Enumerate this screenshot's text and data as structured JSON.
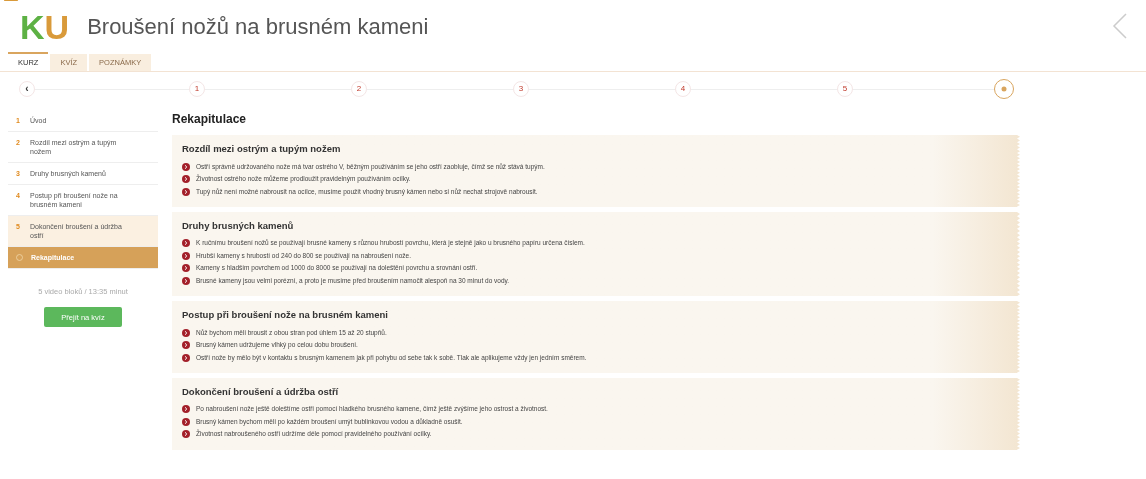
{
  "header": {
    "logo": {
      "left": "K",
      "right": "U"
    },
    "title": "Broušení nožů na brusném kameni"
  },
  "tabs": [
    {
      "label": "KURZ",
      "selected": true
    },
    {
      "label": "KVÍZ",
      "selected": false
    },
    {
      "label": "POZNÁMKY",
      "selected": false
    }
  ],
  "steps": [
    {
      "kind": "prev",
      "label": "‹",
      "selected": false
    },
    {
      "kind": "step",
      "label": "1",
      "selected": false
    },
    {
      "kind": "step",
      "label": "2",
      "selected": false
    },
    {
      "kind": "step",
      "label": "3",
      "selected": false
    },
    {
      "kind": "step",
      "label": "4",
      "selected": false
    },
    {
      "kind": "step",
      "label": "5",
      "selected": false
    },
    {
      "kind": "summary",
      "selected": true
    }
  ],
  "sidebar": {
    "items": [
      {
        "kind": "lesson",
        "number": "1",
        "label": "Úvod",
        "highlighted": false,
        "selected": false
      },
      {
        "kind": "lesson",
        "number": "2",
        "label": "Rozdíl mezi ostrým a tupým nožem",
        "highlighted": false,
        "selected": false
      },
      {
        "kind": "lesson",
        "number": "3",
        "label": "Druhy brusných kamenů",
        "highlighted": false,
        "selected": false
      },
      {
        "kind": "lesson",
        "number": "4",
        "label": "Postup při broušení nože na brusném kameni",
        "highlighted": false,
        "selected": false
      },
      {
        "kind": "lesson",
        "number": "5",
        "label": "Dokončení broušení a údržba ostří",
        "highlighted": true,
        "selected": false
      },
      {
        "kind": "summary",
        "label": "Rekapitulace",
        "highlighted": false,
        "selected": true
      }
    ],
    "summary": "5 video bloků / 13:35 minut",
    "quiz_button": "Přejít na kvíz"
  },
  "content": {
    "title": "Rekapitulace",
    "sections": [
      {
        "heading": "Rozdíl mezi ostrým a tupým nožem",
        "points": [
          "Ostří správně udržovaného nože má tvar ostrého V, běžným používáním se jeho ostří zaobluje, čímž se nůž stává tupým.",
          "Životnost ostrého nože můžeme prodloužit pravidelným používáním ocílky.",
          "Tupý nůž není možné nabrousit na ocílce, musíme použít vhodný brusný kámen nebo si nůž nechat strojově nabrousit."
        ]
      },
      {
        "heading": "Druhy brusných kamenů",
        "points": [
          "K ručnímu broušení nožů se používají brusné kameny s různou hrubostí povrchu, která je stejně jako u brusného papíru určena číslem.",
          "Hrubší kameny s hrubostí od 240 do 800 se používají na nabroušení nože.",
          "Kameny s hladším povrchem od 1000 do 8000 se používají na doleštění povrchu a srovnání ostří.",
          "Brusné kameny jsou velmi porézní, a proto je musíme před broušením namočit alespoň na 30 minut do vody."
        ]
      },
      {
        "heading": "Postup při broušení nože na brusném kameni",
        "points": [
          "Nůž bychom měli brousit z obou stran pod úhlem 15 až 20 stupňů.",
          "Brusný kámen udržujeme vlhký po celou dobu broušení.",
          "Ostří nože by mělo být v kontaktu s brusným kamenem jak při pohybu od sebe tak k sobě. Tlak ale aplikujeme vždy jen jedním směrem."
        ]
      },
      {
        "heading": "Dokončení broušení a údržba ostří",
        "points": [
          "Po nabroušení nože ještě doleštíme ostří pomocí hladkého brusného kamene, čímž ještě zvýšíme jeho ostrost a životnost.",
          "Brusný kámen bychom měli po každém broušení umýt bublinkovou vodou a důkladně osušit.",
          "Životnost nabroušeného ostří udržíme déle pomocí pravidelného používání ocílky."
        ]
      }
    ]
  }
}
